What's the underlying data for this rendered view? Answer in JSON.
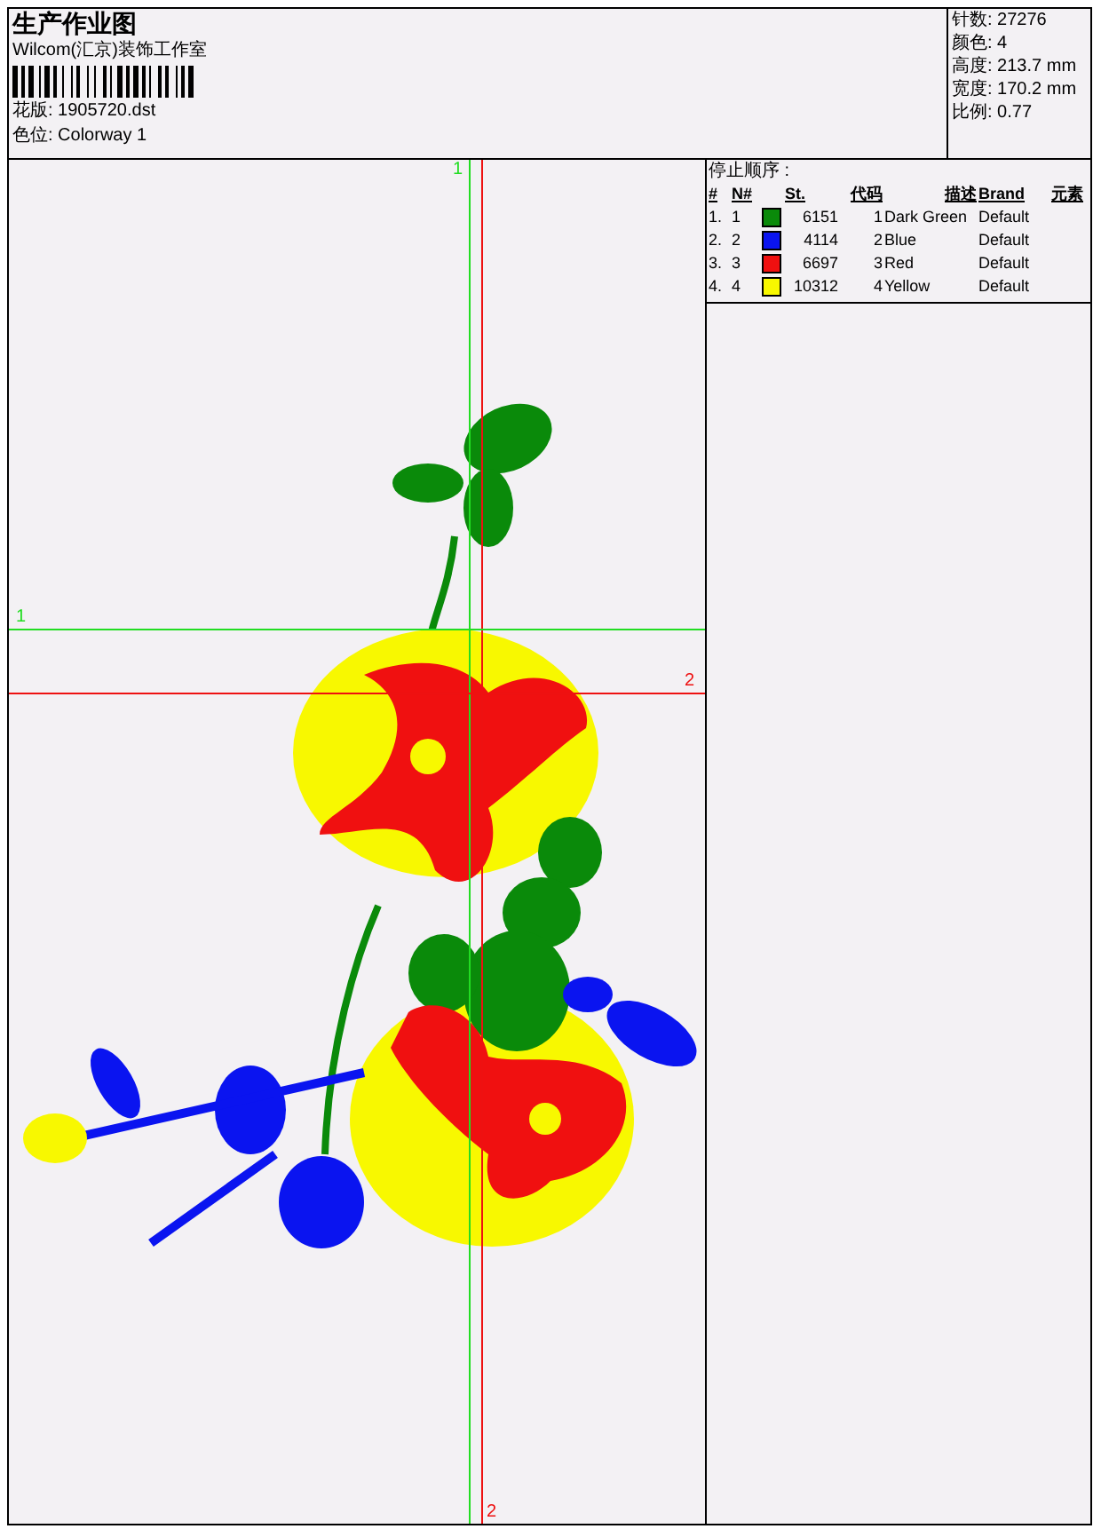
{
  "header": {
    "title": "生产作业图",
    "company": "Wilcom(汇京)装饰工作室",
    "design_file": "花版: 1905720.dst",
    "colorway": "色位: Colorway 1"
  },
  "stats": [
    "针数: 27276",
    "颜色: 4",
    "高度: 213.7 mm",
    "宽度: 170.2 mm",
    "比例: 0.77"
  ],
  "stop_sequence": {
    "title": "停止顺序 :",
    "columns": [
      "#",
      "N#",
      "St.",
      "代码",
      "描述",
      "Brand",
      "元素"
    ],
    "rows": [
      {
        "index": "1.",
        "number": "1",
        "color": "#0a8a0a",
        "stitches": "6151",
        "code": "1",
        "description": "Dark Green",
        "brand": "Default"
      },
      {
        "index": "2.",
        "number": "2",
        "color": "#0a14f0",
        "stitches": "4114",
        "code": "2",
        "description": "Blue",
        "brand": "Default"
      },
      {
        "index": "3.",
        "number": "3",
        "color": "#f01010",
        "stitches": "6697",
        "code": "3",
        "description": "Red",
        "brand": "Default"
      },
      {
        "index": "4.",
        "number": "4",
        "color": "#f8f800",
        "stitches": "10312",
        "code": "4",
        "description": "Yellow",
        "brand": "Default"
      }
    ]
  },
  "guides": [
    {
      "kind": "vertical",
      "label": "1",
      "color": "#22dd22"
    },
    {
      "kind": "vertical",
      "label": "2",
      "color": "#ee1111"
    },
    {
      "kind": "horizontal",
      "label": "1",
      "color": "#22dd22"
    },
    {
      "kind": "horizontal",
      "label": "2",
      "color": "#ee1111"
    }
  ]
}
